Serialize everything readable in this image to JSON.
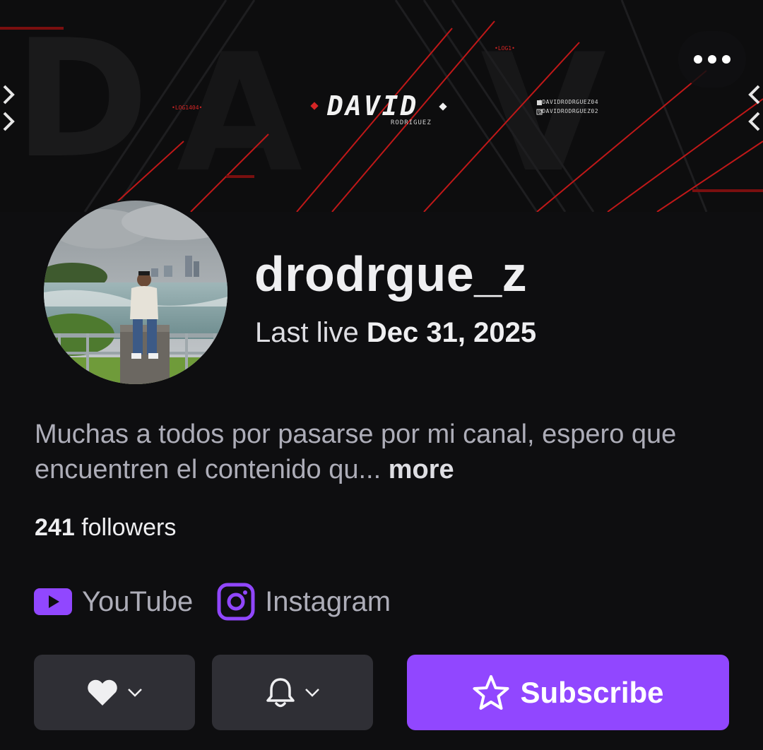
{
  "banner": {
    "title": "DAVID",
    "subtitle": "RODRIGUEZ",
    "social_twitter": "@DAVIDRODRGUEZ04",
    "social_instagram": "@DAVIDRODRGUEZ02",
    "tag_left": "•LOG1404•",
    "tag_top": "•LOG1•"
  },
  "header": {
    "more_icon": "ellipsis-icon"
  },
  "profile": {
    "username": "drodrgue_z",
    "last_live_prefix": "Last live",
    "last_live_date": "Dec 31, 2025",
    "bio": "Muchas a todos por pasarse por mi canal, espero que encuentren el contenido qu...",
    "bio_more": "more",
    "followers_count": "241",
    "followers_label": "followers"
  },
  "links": [
    {
      "label": "YouTube",
      "icon": "youtube-icon"
    },
    {
      "label": "Instagram",
      "icon": "instagram-icon"
    }
  ],
  "actions": {
    "follow_icon": "heart-icon",
    "notify_icon": "bell-icon",
    "subscribe_label": "Subscribe",
    "subscribe_icon": "star-icon"
  },
  "colors": {
    "background": "#0e0e10",
    "accent": "#9147ff",
    "button_secondary": "#2f2f35",
    "banner_red": "#d42525"
  }
}
